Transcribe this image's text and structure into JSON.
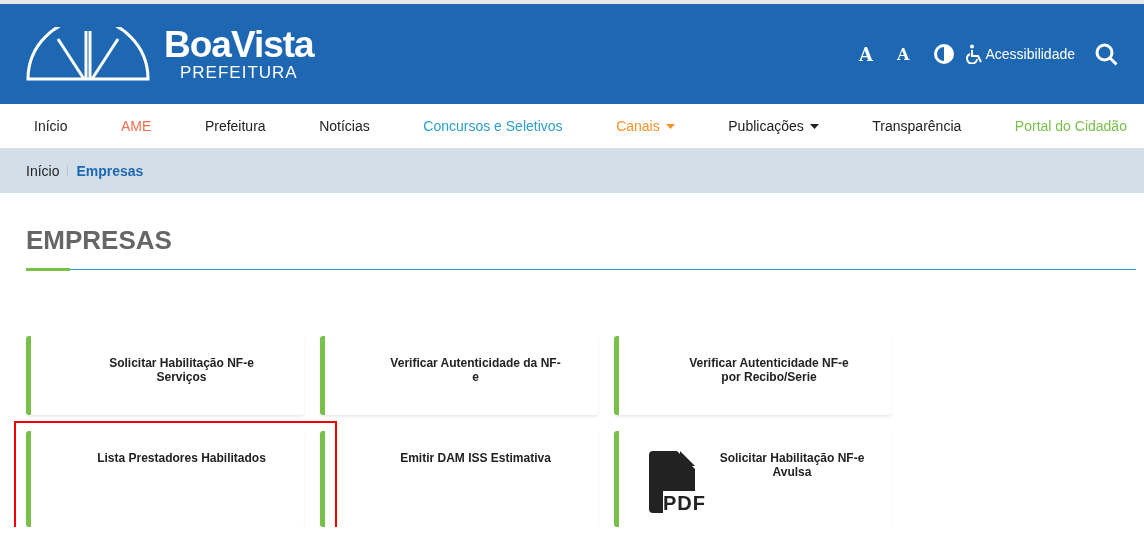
{
  "header": {
    "logo_title": "BoaVista",
    "logo_subtitle": "PREFEITURA",
    "tools": [
      {
        "kind": "font-increase",
        "label": "A"
      },
      {
        "kind": "font-decrease",
        "label": "A"
      },
      {
        "kind": "contrast"
      },
      {
        "kind": "accessibility",
        "label": "Acessibilidade"
      },
      {
        "kind": "search"
      }
    ]
  },
  "nav": [
    {
      "label": "Início",
      "color": "#222222",
      "dropdown": false
    },
    {
      "label": "AME",
      "color": "#f36f4f",
      "dropdown": false
    },
    {
      "label": "Prefeitura",
      "color": "#222222",
      "dropdown": false
    },
    {
      "label": "Notícias",
      "color": "#222222",
      "dropdown": false
    },
    {
      "label": "Concursos e Seletivos",
      "color": "#2a9fd0",
      "dropdown": false
    },
    {
      "label": "Canais",
      "color": "#f7922b",
      "dropdown": true
    },
    {
      "label": "Publicações",
      "color": "#222222",
      "dropdown": true
    },
    {
      "label": "Transparência",
      "color": "#222222",
      "dropdown": false
    },
    {
      "label": "Portal do Cidadão",
      "color": "#78c04a",
      "dropdown": false
    }
  ],
  "breadcrumb": [
    {
      "label": "Início",
      "selected": false
    },
    {
      "label": "Empresas",
      "selected": true
    }
  ],
  "page_title": "EMPRESAS",
  "cards": [
    {
      "lines": [
        "Solicitar Habilitação NF-e",
        "Serviços"
      ],
      "highlighted": false
    },
    {
      "lines": [
        "Verificar Autenticidade da NF-",
        "e"
      ],
      "highlighted": false
    },
    {
      "lines": [
        "Verificar Autenticidade NF-e",
        "por Recibo/Serie"
      ],
      "highlighted": false
    },
    {
      "lines": [
        "Lista Prestadores Habilitados"
      ],
      "highlighted": true
    },
    {
      "lines": [
        "Emitir DAM ISS Estimativa"
      ],
      "highlighted": false
    },
    {
      "lines": [
        "Solicitar Habilitação NF-e",
        "Avulsa"
      ],
      "highlighted": false,
      "icon_label": "PDF"
    }
  ]
}
